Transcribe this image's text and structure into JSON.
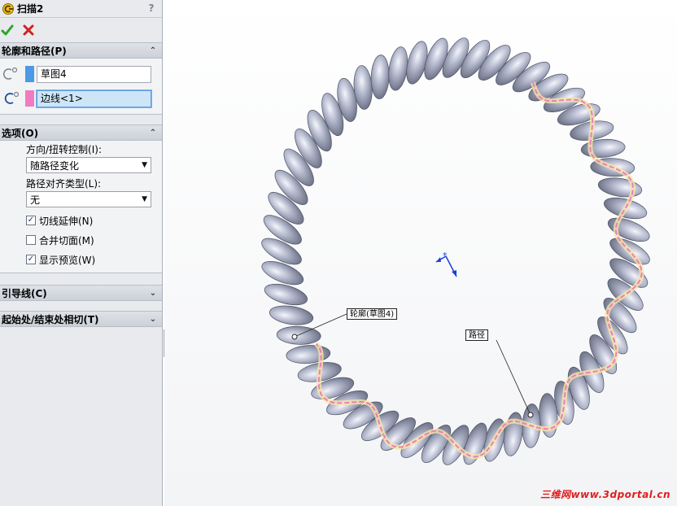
{
  "feature": {
    "title": "扫描2",
    "icon": "sweep-feature-icon",
    "help_label": "?"
  },
  "actions": {
    "ok_icon": "green-checkmark-icon",
    "cancel_icon": "red-x-icon"
  },
  "profile_path": {
    "header": "轮廓和路径(P)",
    "profile_value": "草图4",
    "profile_color": "#4a9ae8",
    "path_value": "边线<1>",
    "path_color": "#f07bbf"
  },
  "options": {
    "header": "选项(O)",
    "orientation_label": "方向/扭转控制(I):",
    "orientation_value": "随路径变化",
    "path_align_label": "路径对齐类型(L):",
    "path_align_value": "无",
    "checkboxes": [
      {
        "label": "切线延伸(N)",
        "checked": true
      },
      {
        "label": "合并切面(M)",
        "checked": false
      },
      {
        "label": "显示预览(W)",
        "checked": true
      }
    ]
  },
  "guide_curves": {
    "header": "引导线(C)"
  },
  "start_end": {
    "header": "起始处/结束处相切(T)"
  },
  "viewport": {
    "callout_profile": "轮廓(草图4)",
    "callout_path": "路径",
    "watermark": "三维网www.3dportal.cn",
    "model_color": "#9aa0b8",
    "highlight_color": "#f07bbf"
  }
}
